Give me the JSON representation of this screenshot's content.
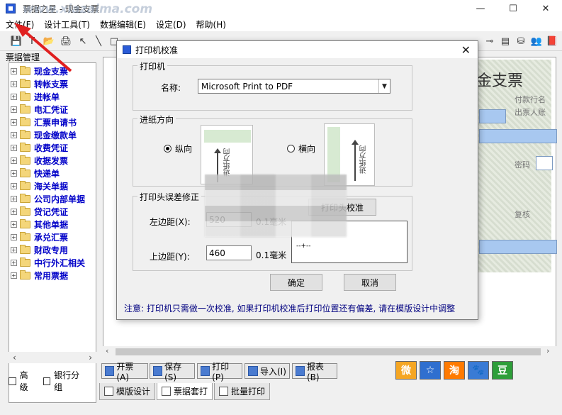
{
  "window": {
    "title": "票据之星 - 现金支票",
    "watermark": "www.xiazaima.com",
    "min_glyph": "—",
    "max_glyph": "☐",
    "close_glyph": "✕"
  },
  "menu": [
    "文件(F)",
    "设计工具(T)",
    "数据编辑(E)",
    "设定(D)",
    "帮助(H)"
  ],
  "left_panel": {
    "header": "票据管理",
    "items": [
      "现金支票",
      "转帐支票",
      "进帐单",
      "电汇凭证",
      "汇票申请书",
      "现金缴款单",
      "收费凭证",
      "收据发票",
      "快递单",
      "海关单据",
      "公司内部单据",
      "贷记凭证",
      "其他单据",
      "承兑汇票",
      "财政专用",
      "中行外汇相关",
      "常用票据"
    ],
    "checkbox_advanced": "高级",
    "checkbox_bank_group": "银行分组"
  },
  "document": {
    "title": "金支票",
    "payee_label": "付款行名",
    "drawer_label": "出票人账",
    "password_label": "密码",
    "review_label": "复核"
  },
  "bottom_buttons": [
    "开票(A)",
    "保存(S)",
    "打印(P)",
    "导入(I)",
    "报表(B)"
  ],
  "social_icons": [
    "weibo-icon",
    "star-icon",
    "taobao-icon",
    "paw-icon",
    "douban-icon"
  ],
  "social_labels": [
    "微",
    "☆",
    "淘",
    "🐾",
    "豆"
  ],
  "tabs": [
    "模版设计",
    "票据套打",
    "批量打印"
  ],
  "dialog": {
    "title": "打印机校准",
    "printer_group": "打印机",
    "name_label": "名称:",
    "printer_name": "Microsoft Print to PDF",
    "feed_group": "进纸方向",
    "portrait": "纵向",
    "landscape": "横向",
    "feed_text": "进纸方向",
    "offset_group": "打印头误差修正",
    "left_margin_label": "左边距(X):",
    "left_margin_value": "520",
    "top_margin_label": "上边距(Y):",
    "top_margin_value": "460",
    "unit": "0.1毫米",
    "calibrate_button": "打印头校准",
    "ok": "确定",
    "cancel": "取消",
    "note": "注意: 打印机只需做一次校准, 如果打印机校准后打印位置还有偏差, 请在模版设计中调整"
  },
  "colors": {
    "tree_text": "#0000c8",
    "note_text": "#000080",
    "arrow": "#e02020"
  }
}
